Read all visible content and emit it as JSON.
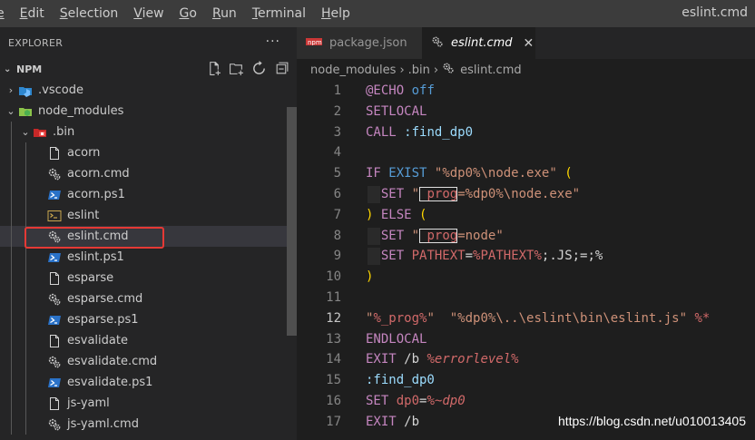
{
  "menubar": {
    "items": [
      {
        "pre": "",
        "u": "e",
        "post": ""
      },
      {
        "pre": "",
        "u": "E",
        "post": "dit"
      },
      {
        "pre": "",
        "u": "S",
        "post": "election"
      },
      {
        "pre": "",
        "u": "V",
        "post": "iew"
      },
      {
        "pre": "",
        "u": "G",
        "post": "o"
      },
      {
        "pre": "",
        "u": "R",
        "post": "un"
      },
      {
        "pre": "",
        "u": "T",
        "post": "erminal"
      },
      {
        "pre": "",
        "u": "H",
        "post": "elp"
      }
    ],
    "window_title": "eslint.cmd"
  },
  "sidebar": {
    "title": "EXPLORER",
    "more": "···",
    "section": "NPM",
    "tree": [
      {
        "label": ".vscode",
        "icon": "vscode-folder-icon",
        "depth": 0,
        "chev": "›"
      },
      {
        "label": "node_modules",
        "icon": "node-folder-icon",
        "depth": 0,
        "chev": "⌄"
      },
      {
        "label": ".bin",
        "icon": "npm-folder-icon",
        "depth": 1,
        "chev": "⌄"
      },
      {
        "label": "acorn",
        "icon": "file-icon",
        "depth": 2
      },
      {
        "label": "acorn.cmd",
        "icon": "gear-file-icon",
        "depth": 2
      },
      {
        "label": "acorn.ps1",
        "icon": "powershell-icon",
        "depth": 2
      },
      {
        "label": "eslint",
        "icon": "terminal-icon",
        "depth": 2
      },
      {
        "label": "eslint.cmd",
        "icon": "gear-file-icon",
        "depth": 2,
        "selected": true
      },
      {
        "label": "eslint.ps1",
        "icon": "powershell-icon",
        "depth": 2
      },
      {
        "label": "esparse",
        "icon": "file-icon",
        "depth": 2
      },
      {
        "label": "esparse.cmd",
        "icon": "gear-file-icon",
        "depth": 2
      },
      {
        "label": "esparse.ps1",
        "icon": "powershell-icon",
        "depth": 2
      },
      {
        "label": "esvalidate",
        "icon": "file-icon",
        "depth": 2
      },
      {
        "label": "esvalidate.cmd",
        "icon": "gear-file-icon",
        "depth": 2
      },
      {
        "label": "esvalidate.ps1",
        "icon": "powershell-icon",
        "depth": 2
      },
      {
        "label": "js-yaml",
        "icon": "file-icon",
        "depth": 2
      },
      {
        "label": "js-yaml.cmd",
        "icon": "gear-file-icon",
        "depth": 2
      }
    ]
  },
  "tabs": [
    {
      "label": "package.json",
      "icon": "npm-icon",
      "active": false
    },
    {
      "label": "eslint.cmd",
      "icon": "gear-icon",
      "active": true,
      "close": "✕"
    }
  ],
  "breadcrumb": [
    "node_modules",
    ".bin",
    "eslint.cmd"
  ],
  "editor": {
    "active_line": 12,
    "lines": [
      {
        "n": "1",
        "t": [
          [
            "cmd",
            "@ECHO"
          ],
          [
            "txt",
            " "
          ],
          [
            "bl",
            "off"
          ]
        ]
      },
      {
        "n": "2",
        "t": [
          [
            "cmd",
            "SETLOCAL"
          ]
        ]
      },
      {
        "n": "3",
        "t": [
          [
            "cmd",
            "CALL"
          ],
          [
            "txt",
            " "
          ],
          [
            "lbl",
            ":find_dp0"
          ]
        ]
      },
      {
        "n": "4",
        "t": []
      },
      {
        "n": "5",
        "t": [
          [
            "kw",
            "IF"
          ],
          [
            "txt",
            " "
          ],
          [
            "bl",
            "EXIST"
          ],
          [
            "txt",
            " "
          ],
          [
            "str",
            "\"%dp0%\\node.exe\""
          ],
          [
            "txt",
            " "
          ],
          [
            "par",
            "("
          ]
        ]
      },
      {
        "n": "6",
        "g": true,
        "t": [
          [
            "txt",
            "  "
          ],
          [
            "cmd",
            "SET"
          ],
          [
            "txt",
            " "
          ],
          [
            "str",
            "\""
          ],
          [
            "varb",
            "_prog"
          ],
          [
            "str",
            "=%dp0%\\node.exe\""
          ]
        ]
      },
      {
        "n": "7",
        "t": [
          [
            "par",
            ")"
          ],
          [
            "txt",
            " "
          ],
          [
            "kw",
            "ELSE"
          ],
          [
            "txt",
            " "
          ],
          [
            "par",
            "("
          ]
        ]
      },
      {
        "n": "8",
        "g": true,
        "t": [
          [
            "txt",
            "  "
          ],
          [
            "cmd",
            "SET"
          ],
          [
            "txt",
            " "
          ],
          [
            "str",
            "\""
          ],
          [
            "varb",
            "_prog"
          ],
          [
            "str",
            "=node\""
          ]
        ]
      },
      {
        "n": "9",
        "g": true,
        "t": [
          [
            "txt",
            "  "
          ],
          [
            "cmd",
            "SET"
          ],
          [
            "txt",
            " "
          ],
          [
            "var",
            "PATHEXT"
          ],
          [
            "txt",
            "="
          ],
          [
            "var",
            "%PATHEXT%"
          ],
          [
            "txt",
            ";.JS;=;%"
          ]
        ]
      },
      {
        "n": "10",
        "t": [
          [
            "par",
            ")"
          ]
        ]
      },
      {
        "n": "11",
        "t": []
      },
      {
        "n": "12",
        "t": [
          [
            "str",
            "\""
          ],
          [
            "var",
            "%_prog%"
          ],
          [
            "str",
            "\""
          ],
          [
            "txt",
            "  "
          ],
          [
            "str",
            "\"%dp0%\\..\\eslint\\bin\\eslint.js\""
          ],
          [
            "txt",
            " "
          ],
          [
            "var",
            "%*"
          ]
        ]
      },
      {
        "n": "13",
        "t": [
          [
            "cmd",
            "ENDLOCAL"
          ]
        ]
      },
      {
        "n": "14",
        "t": [
          [
            "cmd",
            "EXIT"
          ],
          [
            "txt",
            " /b "
          ],
          [
            "vari",
            "%errorlevel%"
          ]
        ]
      },
      {
        "n": "15",
        "t": [
          [
            "lbl",
            ":find_dp0"
          ]
        ]
      },
      {
        "n": "16",
        "t": [
          [
            "cmd",
            "SET"
          ],
          [
            "txt",
            " "
          ],
          [
            "var",
            "dp0"
          ],
          [
            "txt",
            "="
          ],
          [
            "var",
            "%"
          ],
          [
            "vari",
            "~dp0"
          ]
        ]
      },
      {
        "n": "17",
        "t": [
          [
            "cmd",
            "EXIT"
          ],
          [
            "txt",
            " /b"
          ]
        ]
      }
    ]
  },
  "watermark": "https://blog.csdn.net/u010013405"
}
